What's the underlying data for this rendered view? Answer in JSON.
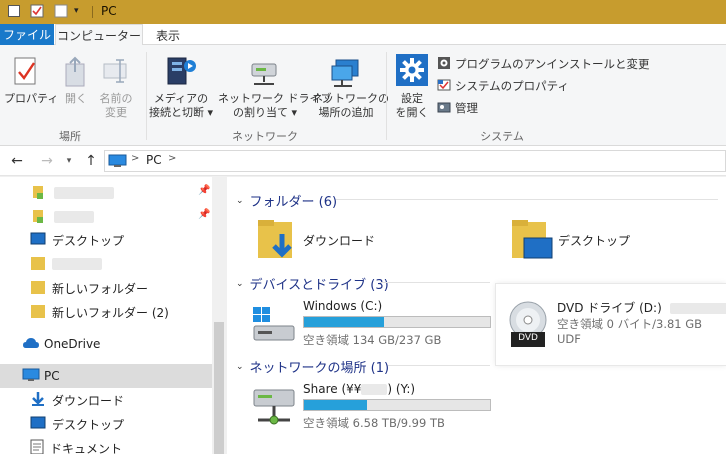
{
  "window": {
    "title": "PC"
  },
  "menu": {
    "file": "ファイル",
    "computer": "コンピューター",
    "view": "表示"
  },
  "ribbon": {
    "properties": [
      "プロパティ"
    ],
    "open": [
      "開く"
    ],
    "rename": [
      "名前の",
      "変更"
    ],
    "group_location": "場所",
    "media": [
      "メディアの",
      "接続と切断 ▾"
    ],
    "map_drive": [
      "ネットワーク ドライブ",
      "の割り当て ▾"
    ],
    "add_location": [
      "ネットワークの",
      "場所の追加"
    ],
    "group_network": "ネットワーク",
    "settings": [
      "設定",
      "を開く"
    ],
    "uninstall": "プログラムのアンインストールと変更",
    "system_props": "システムのプロパティ",
    "manage": "管理",
    "group_system": "システム"
  },
  "address": {
    "location": "PC",
    "sep": ">"
  },
  "nav": {
    "desktop": "デスクトップ",
    "new_folder": "新しいフォルダー",
    "new_folder2": "新しいフォルダー (2)",
    "onedrive": "OneDrive",
    "pc": "PC",
    "downloads": "ダウンロード",
    "desktop2": "デスクトップ",
    "documents": "ドキュメント"
  },
  "sections": {
    "folders": "フォルダー (6)",
    "devices": "デバイスとドライブ (3)",
    "network": "ネットワークの場所 (1)"
  },
  "folders": [
    {
      "name": "ダウンロード"
    },
    {
      "name": "デスクトップ"
    }
  ],
  "drives": {
    "c": {
      "name": "Windows (C:)",
      "free": "空き領域 134 GB/237 GB",
      "used_fraction": 0.43
    },
    "d": {
      "name": "DVD ドライブ (D:)",
      "free": "空き領域 0 バイト/3.81 GB",
      "fs": "UDF",
      "badge": "DVD"
    },
    "y": {
      "name_prefix": "Share (¥¥",
      "name_suffix": ") (Y:)",
      "free": "空き領域 6.58 TB/9.99 TB",
      "used_fraction": 0.34
    }
  },
  "colors": {
    "titlebar": "#c79c2e",
    "file_tab": "#1979ca",
    "bar_fill": "#26a0da",
    "section_heading": "#1e3287"
  }
}
